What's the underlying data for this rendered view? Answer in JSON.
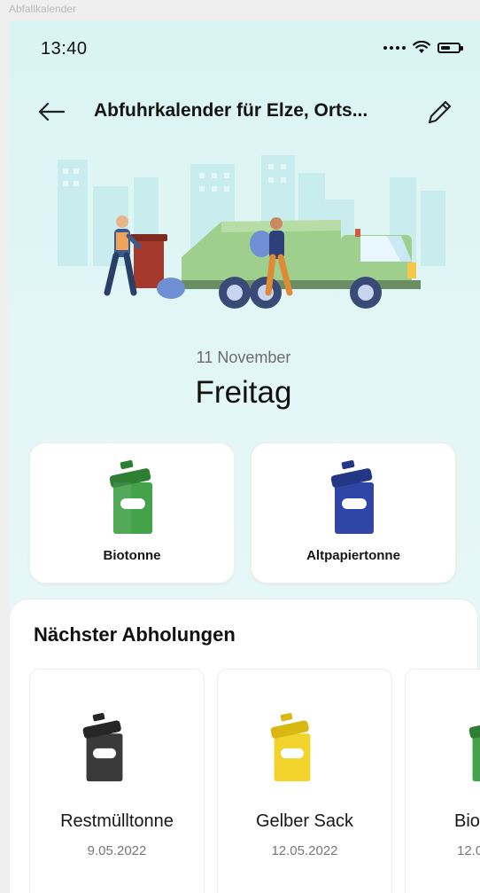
{
  "window": {
    "title": "Abfallkalender"
  },
  "status_bar": {
    "time": "13:40"
  },
  "header": {
    "title": "Abfuhrkalender für Elze, Orts..."
  },
  "today": {
    "date": "11 November",
    "weekday": "Freitag",
    "bins": [
      {
        "label": "Biotonne",
        "color": "#44a24a",
        "lid_color": "#2e7f33"
      },
      {
        "label": "Altpapiertonne",
        "color": "#2f46a6",
        "lid_color": "#243785"
      }
    ]
  },
  "upcoming": {
    "title": "Nächster Abholungen",
    "items": [
      {
        "name": "Restmülltonne",
        "date": "9.05.2022",
        "color": "#3a3a3a",
        "lid_color": "#262626"
      },
      {
        "name": "Gelber Sack",
        "date": "12.05.2022",
        "color": "#f2d32b",
        "lid_color": "#d9b812"
      },
      {
        "name": "Bio",
        "date": "12.0",
        "color": "#44a24a",
        "lid_color": "#2e7f33"
      }
    ]
  }
}
